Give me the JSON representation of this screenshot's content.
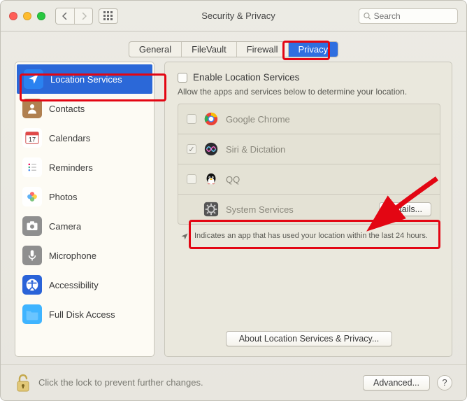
{
  "window": {
    "title": "Security & Privacy"
  },
  "search": {
    "placeholder": "Search"
  },
  "tabs": {
    "items": [
      "General",
      "FileVault",
      "Firewall",
      "Privacy"
    ],
    "selected": "Privacy"
  },
  "sidebar": {
    "selected": "Location Services",
    "items": [
      {
        "label": "Location Services",
        "icon": "location-icon",
        "bg": "#2a82f0"
      },
      {
        "label": "Contacts",
        "icon": "contacts-icon",
        "bg": "#b08050"
      },
      {
        "label": "Calendars",
        "icon": "calendar-icon",
        "bg": "#ffffff"
      },
      {
        "label": "Reminders",
        "icon": "reminders-icon",
        "bg": "#ffffff"
      },
      {
        "label": "Photos",
        "icon": "photos-icon",
        "bg": "#ffffff"
      },
      {
        "label": "Camera",
        "icon": "camera-icon",
        "bg": "#8f8f8f"
      },
      {
        "label": "Microphone",
        "icon": "microphone-icon",
        "bg": "#8f8f8f"
      },
      {
        "label": "Accessibility",
        "icon": "accessibility-icon",
        "bg": "#2a63d8"
      },
      {
        "label": "Full Disk Access",
        "icon": "folder-icon",
        "bg": "#3fb4ff"
      }
    ]
  },
  "content": {
    "enable_label": "Enable Location Services",
    "enable_checked": false,
    "desc": "Allow the apps and services below to determine your location.",
    "apps": [
      {
        "name": "Google Chrome",
        "checked": false,
        "icon": "chrome-icon"
      },
      {
        "name": "Siri & Dictation",
        "checked": true,
        "icon": "siri-icon"
      },
      {
        "name": "QQ",
        "checked": false,
        "icon": "qq-icon"
      },
      {
        "name": "System Services",
        "checked": null,
        "icon": "gear-icon",
        "details_button": "Details..."
      }
    ],
    "indicator_note": "Indicates an app that has used your location within the last 24 hours.",
    "about_button": "About Location Services & Privacy..."
  },
  "footer": {
    "lock_text": "Click the lock to prevent further changes.",
    "advanced_button": "Advanced...",
    "help_tooltip": "?"
  },
  "annotations": {
    "highlights": [
      "privacy-tab",
      "location-services-sidebar",
      "system-services-row"
    ],
    "arrow_target": "details-button"
  }
}
